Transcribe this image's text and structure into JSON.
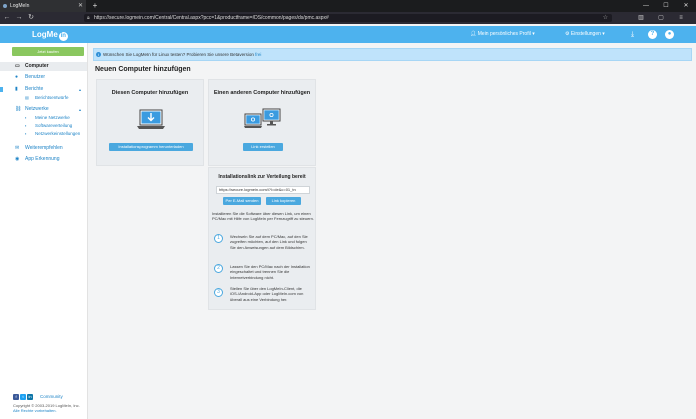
{
  "browser": {
    "tab_title": "LogMeIn",
    "new_tab_symbol": "+",
    "url": "https://secure.logmein.com/Central/Central.aspx?pcc=1&productframe=/DS/common/pages/ds/pmc.aspx#",
    "back_symbol": "←",
    "forward_symbol": "→",
    "reload_symbol": "↻",
    "menu_symbol": "≡",
    "window_min": "—",
    "window_max": "☐",
    "window_close": "✕"
  },
  "header": {
    "logo_text": "LogMe",
    "logo_badge": "in",
    "profile_label": "Mein persönliches Profil",
    "settings_label": "Einstellungen",
    "profile_icon": "user-icon",
    "settings_icon": "gear-icon",
    "help_symbol": "?",
    "accent_color": "#4db2ee"
  },
  "sidebar": {
    "top_button": "Jetzt kaufen",
    "items": [
      {
        "label": "Computer",
        "icon": "monitor-icon",
        "active": true
      },
      {
        "label": "Benutzer",
        "icon": "user-icon"
      },
      {
        "label": "Berichte",
        "icon": "chart-icon"
      },
      {
        "label": "Netzwerke",
        "icon": "network-icon"
      },
      {
        "label": "Weiterempfehlen",
        "icon": "share-icon"
      },
      {
        "label": "App Erkennung",
        "icon": "app-icon"
      }
    ],
    "report_sub": [
      "Berichtsentwürfe"
    ],
    "network_sub": [
      "Meine Netzwerke",
      "Softwareverteilung",
      "Netzwerkeinstellungen"
    ],
    "community_label": "Community",
    "copyright": "Copyright © 2003-2019 LogMeIn, Inc.",
    "terms": "Alle Rechte vorbehalten."
  },
  "banner": {
    "text": "Wünschen Sie LogMeIn für Linux testen? Probieren Sie unsere Betaversion",
    "link": "frei"
  },
  "main": {
    "page_title": "Neuen Computer hinzufügen",
    "card_this": {
      "title": "Diesen Computer hinzufügen",
      "button": "Installationsprogramm herunterladen"
    },
    "card_other": {
      "title": "Einen anderen Computer hinzufügen",
      "button": "Link erstellen"
    },
    "link_panel": {
      "title": "Installationslink zur Verteilung bereit",
      "link_value": "https://secure.logmein.com/i?l=de&c=01_tn",
      "email_button": "Per E-Mail senden",
      "copy_button": "Link kopieren",
      "intro": "Installieren Sie die Software über diesen Link, um einen PC/Mac mit Hilfe von LogMeIn per Fernzugriff zu steuern.",
      "steps": [
        {
          "num": "1",
          "text": "Wechseln Sie auf dem PC/Mac, auf den Sie zugreifen möchten, auf den Link und folgen Sie den Anweisungen auf dem Bildschirm."
        },
        {
          "num": "2",
          "text": "Lassen Sie den PC/Mac nach der Installation eingeschaltet und trennen Sie die Internetverbindung nicht."
        },
        {
          "num": "3",
          "text": "Stellen Sie über den LogMeIn-Client, die iOS-/Android-App oder LogMeIn.com von überall aus eine Verbindung her."
        }
      ]
    }
  }
}
